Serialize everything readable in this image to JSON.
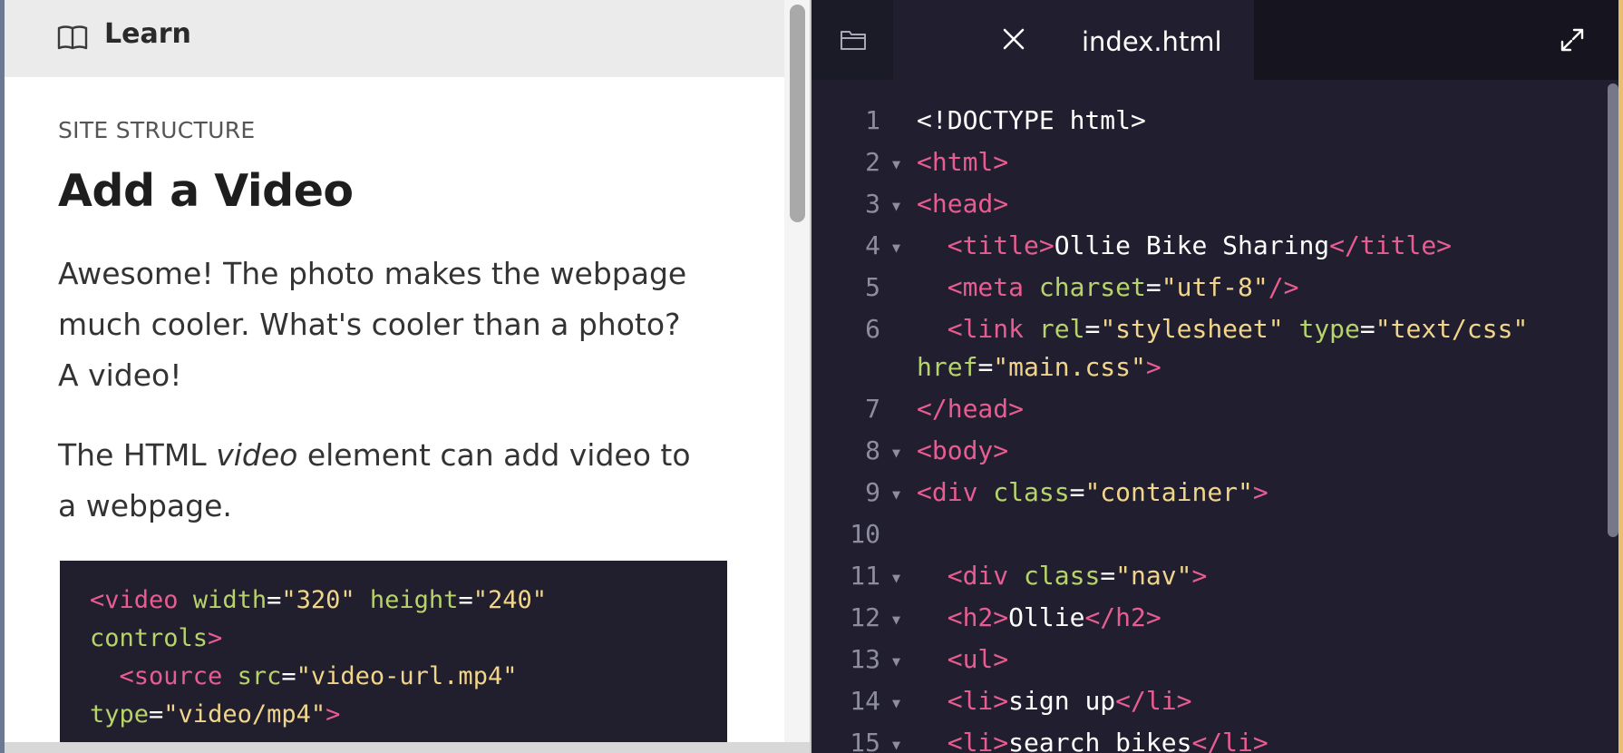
{
  "learn_panel": {
    "header_title": "Learn",
    "section_label": "SITE STRUCTURE",
    "lesson_title": "Add a Video",
    "paragraph1": "Awesome! The photo makes the webpage much cooler. What's cooler than a photo? A video!",
    "paragraph2": {
      "before": "The HTML ",
      "emphasis": "video",
      "after": " element can add video to a webpage."
    },
    "code_example": {
      "line1": {
        "tag_open": "<video",
        "attr1": "width",
        "val1": "\"320\"",
        "attr2": "height",
        "val2": "\"240\""
      },
      "line2": {
        "attr": "controls",
        "tag_close": ">"
      },
      "line3": {
        "tag_open": "<source",
        "attr": "src",
        "val": "\"video-url.mp4\""
      },
      "line4": {
        "attr": "type",
        "val": "\"video/mp4\"",
        "tag_close": ">"
      }
    }
  },
  "editor": {
    "tab_label": "index.html",
    "icons": [
      "folder-icon",
      "close-icon",
      "expand-icon"
    ],
    "line_numbers": [
      "1",
      "2",
      "3",
      "4",
      "5",
      "6",
      "7",
      "8",
      "9",
      "10",
      "11",
      "12",
      "13",
      "14",
      "15"
    ],
    "code": {
      "l1": "<!DOCTYPE html>",
      "l2": "<html>",
      "l3": "<head>",
      "l4": {
        "open": "<title>",
        "text": "Ollie Bike Sharing",
        "close": "</title>"
      },
      "l5": {
        "open": "<meta",
        "attr": "charset",
        "val": "\"utf-8\"",
        "close": "/>"
      },
      "l6a": {
        "open": "<link",
        "attr1": "rel",
        "val1": "\"stylesheet\"",
        "attr2": "type",
        "val2": "\"text/css\""
      },
      "l6b": {
        "attr": "href",
        "val": "\"main.css\"",
        "close": ">"
      },
      "l7": "</head>",
      "l8": "<body>",
      "l9": {
        "open": "<div",
        "attr": "class",
        "val": "\"container\"",
        "close": ">"
      },
      "l11": {
        "open": "<div",
        "attr": "class",
        "val": "\"nav\"",
        "close": ">"
      },
      "l12": {
        "open": "<h2>",
        "text": "Ollie",
        "close": "</h2>"
      },
      "l13": "<ul>",
      "l14": {
        "open": "<li>",
        "text": "sign up",
        "close": "</li>"
      },
      "l15": {
        "open": "<li>",
        "text": "search bikes",
        "close": "</li>"
      }
    }
  },
  "colors": {
    "editor_bg": "#211f2f",
    "tag": "#e85d91",
    "attribute": "#b7d46a",
    "string": "#f1d58a",
    "accent": "#e8c06b"
  }
}
